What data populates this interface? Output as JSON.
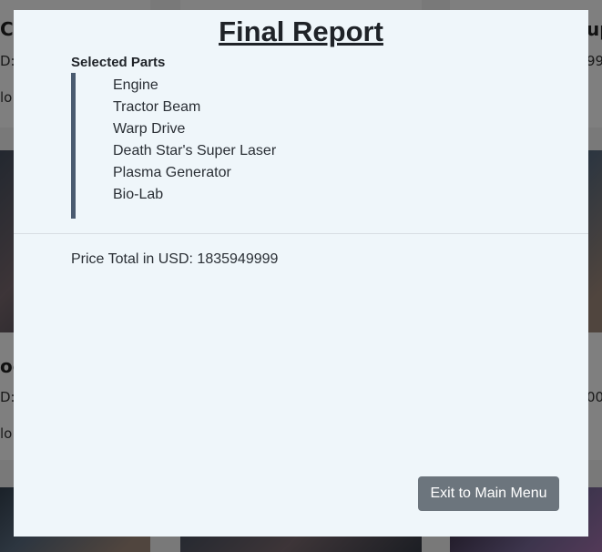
{
  "modal": {
    "title": "Final Report",
    "section_label": "Selected Parts",
    "parts": [
      "Engine",
      "Tractor Beam",
      "Warp Drive",
      "Death Star's Super Laser",
      "Plasma Generator",
      "Bio-Lab"
    ],
    "total_label": "Price Total in USD: 1835949999",
    "exit_label": "Exit to Main Menu"
  },
  "background": {
    "left_heading_top": "Co",
    "left_price_top": "D:",
    "left_meta_top": "lo",
    "right_heading_top": "up",
    "right_price_top": "99",
    "left_heading_mid": "oc",
    "left_price_mid": "D:",
    "left_meta_mid": "lo",
    "right_price_mid": "00"
  },
  "colors": {
    "modal_bg": "#eff6fa",
    "button_bg": "#6c757d",
    "accent_border": "#4a5b70"
  }
}
